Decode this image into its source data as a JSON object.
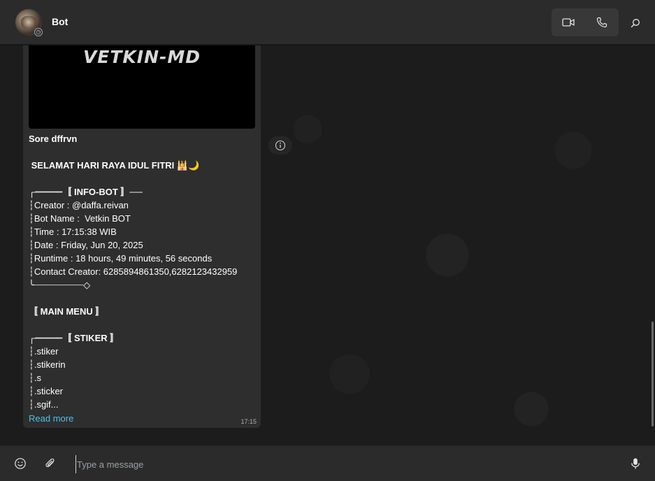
{
  "header": {
    "title": "Bot",
    "status_icon": "clock-icon"
  },
  "message": {
    "media_text": "VETKIN-MD",
    "lines": [
      "Sore dffrvn",
      " SELAMAT HARI RAYA IDUL FITRI 🕌🌙",
      "┌┈┈┈┈┈〚 INFO-BOT 〛──",
      "┆Creator : @daffa.reivan",
      "┆Bot Name :  Vetkin BOT",
      "┆Time : 17:15:38 WIB",
      "┆Date : Friday, Jun 20, 2025",
      "┆Runtime : 18 hours, 49 minutes, 56 seconds",
      "┆Contact Creator: 6285894861350,6282123432959",
      "╰┈┈┈┈┈┈┈┈┈◇",
      "〚 MAIN MENU 〛",
      "┌┈┈┈┈┈〚 STIKER 〛",
      "┆.stiker",
      "┆.stikerin",
      "┆.s",
      "┆.sticker",
      "┆.sgif..."
    ],
    "read_more": "Read more",
    "time": "17:15"
  },
  "composer": {
    "placeholder": "Type a message"
  },
  "colors": {
    "accent_link": "#53bdeb",
    "bubble": "#2e2e2e",
    "header": "#2b2b2b"
  }
}
